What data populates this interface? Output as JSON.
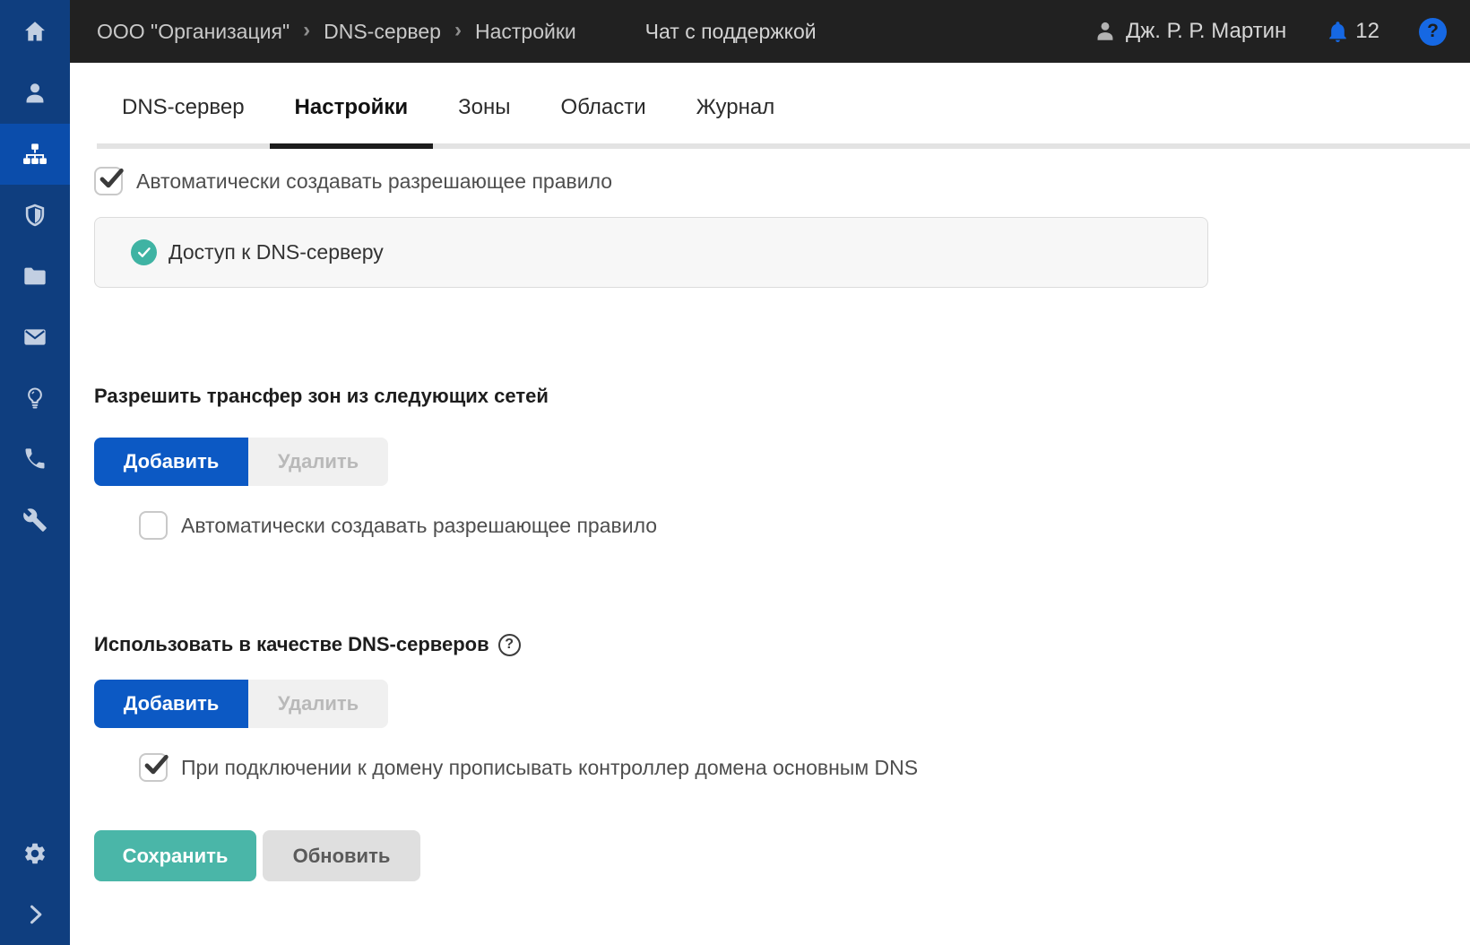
{
  "topbar": {
    "breadcrumb": {
      "items": [
        "ООО \"Организация\"",
        "DNS-сервер",
        "Настройки"
      ],
      "separator": "›"
    },
    "chat_label": "Чат с поддержкой",
    "user_name": "Дж. Р. Р. Мартин",
    "notifications": {
      "count": "12"
    },
    "help_glyph": "?"
  },
  "sidebar": {
    "items": [
      {
        "name": "home"
      },
      {
        "name": "users"
      },
      {
        "name": "network",
        "active": true
      },
      {
        "name": "security"
      },
      {
        "name": "files"
      },
      {
        "name": "mail"
      },
      {
        "name": "ideas"
      },
      {
        "name": "phone"
      },
      {
        "name": "tools"
      },
      {
        "name": "settings"
      },
      {
        "name": "collapse"
      }
    ]
  },
  "tabs": [
    {
      "label": "DNS-сервер",
      "active": false
    },
    {
      "label": "Настройки",
      "active": true
    },
    {
      "label": "Зоны",
      "active": false
    },
    {
      "label": "Области",
      "active": false
    },
    {
      "label": "Журнал",
      "active": false
    }
  ],
  "content": {
    "auto_rule": {
      "label": "Автоматически создавать разрешающее правило",
      "checked": true
    },
    "access_item": {
      "label": "Доступ к DNS-серверу",
      "status": "enabled"
    },
    "zone_transfer": {
      "title": "Разрешить трансфер зон из следующих сетей",
      "add_label": "Добавить",
      "delete_label": "Удалить",
      "auto_rule": {
        "label": "Автоматически создавать разрешающее правило",
        "checked": false
      }
    },
    "dns_servers": {
      "title": "Использовать в качестве DNS-серверов",
      "help_glyph": "?",
      "add_label": "Добавить",
      "delete_label": "Удалить",
      "domain_rule": {
        "label": "При подключении к домену прописывать контроллер домена основным DNS",
        "checked": true
      }
    },
    "actions": {
      "save_label": "Сохранить",
      "refresh_label": "Обновить"
    }
  },
  "colors": {
    "sidebar": "#0f3e7f",
    "sidebar_active": "#0b4dab",
    "topbar": "#212121",
    "accent_blue": "#0c59c4",
    "notification_blue": "#1668e3",
    "teal": "#3fb3a3",
    "save_teal": "#4ab6a8",
    "tab_underline_active": "#1c1c1c",
    "tab_underline": "#e3e3e3"
  }
}
